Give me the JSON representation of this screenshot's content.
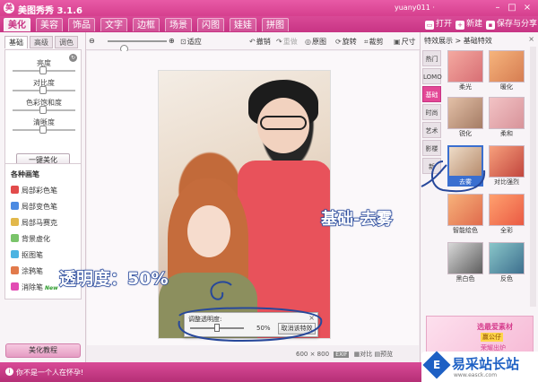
{
  "app": {
    "title": "美图秀秀 3.1.6",
    "logo_glyph": "美",
    "user": "yuany011 ·"
  },
  "window_controls": {
    "minimize": "–",
    "maximize": "□",
    "close": "×"
  },
  "menu_tabs": [
    "美化",
    "美容",
    "饰品",
    "文字",
    "边框",
    "场景",
    "闪图",
    "娃娃",
    "拼图"
  ],
  "top_actions": {
    "open": "打开",
    "new": "新建",
    "save": "保存与分享"
  },
  "toolbar": {
    "fit": "适应",
    "undo": "撤销",
    "redo": "重做",
    "original": "原图",
    "rotate": "旋转",
    "crop": "裁剪",
    "size": "尺寸"
  },
  "left_panel": {
    "tabs": [
      "基础",
      "高级",
      "调色"
    ],
    "adjust": [
      {
        "label": "亮度",
        "value": 0.5
      },
      {
        "label": "对比度",
        "value": 0.5
      },
      {
        "label": "色彩饱和度",
        "value": 0.5
      },
      {
        "label": "清晰度",
        "value": 0.5
      }
    ],
    "one_click": "一键美化",
    "brushes_title": "各种画笔",
    "brushes": [
      {
        "label": "局部彩色笔",
        "color": "#e24b4b"
      },
      {
        "label": "局部变色笔",
        "color": "#4b8ae2"
      },
      {
        "label": "局部马赛克",
        "color": "#e2b84b"
      },
      {
        "label": "背景虚化",
        "color": "#7ac46a"
      },
      {
        "label": "抠图笔",
        "color": "#4bb3e2"
      },
      {
        "label": "涂鸦笔",
        "color": "#e27a4b"
      },
      {
        "label": "消除笔",
        "color": "#e24bb3",
        "badge": "New"
      }
    ],
    "tutorial": "美化教程"
  },
  "canvas": {
    "dialog": {
      "title": "调整透明度:",
      "value": "50%",
      "cancel": "取消该特效",
      "close": "×",
      "level": 0.5
    },
    "status": {
      "size": "600 × 800",
      "exif": "EXIF",
      "compare": "对比",
      "preview": "预览"
    }
  },
  "annotations": {
    "opacity": "透明度：50%",
    "effect": "基础-去雾"
  },
  "right_panel": {
    "header": "特效展示 > 基础特效",
    "close": "×",
    "categories": [
      "热门",
      "LOMO",
      "基础",
      "时尚",
      "艺术",
      "影楼",
      "新"
    ],
    "active_category": "基础",
    "effects": [
      {
        "label": "柔光",
        "colors": [
          "#f4a9a0",
          "#d86f75"
        ]
      },
      {
        "label": "暖化",
        "colors": [
          "#f6b47c",
          "#d67d52"
        ]
      },
      {
        "label": "锐化",
        "colors": [
          "#e3c0a7",
          "#a57c65"
        ]
      },
      {
        "label": "柔和",
        "colors": [
          "#f2c3c5",
          "#d8939a"
        ]
      },
      {
        "label": "去雾",
        "colors": [
          "#eedcc8",
          "#b78c6d"
        ],
        "selected": true
      },
      {
        "label": "对比强烈",
        "colors": [
          "#f7a07c",
          "#c2463e"
        ]
      },
      {
        "label": "智能绘色",
        "colors": [
          "#f7b27a",
          "#e06b4d"
        ]
      },
      {
        "label": "全彩",
        "colors": [
          "#ffa16e",
          "#ea5a44"
        ]
      },
      {
        "label": "黑白色",
        "colors": [
          "#d8d8d8",
          "#5e5e5e"
        ]
      },
      {
        "label": "反色",
        "colors": [
          "#89c6c9",
          "#3d6f8e"
        ]
      }
    ],
    "ad": {
      "line1": "选最爱素材",
      "line2": "赢公仔",
      "line3": "荣耀出炉"
    }
  },
  "bottombar": {
    "message": "你不是一个人在怀孕!"
  },
  "watermark": {
    "title": "易采站长站",
    "url": "www.easck.com",
    "logo_glyph": "E"
  }
}
